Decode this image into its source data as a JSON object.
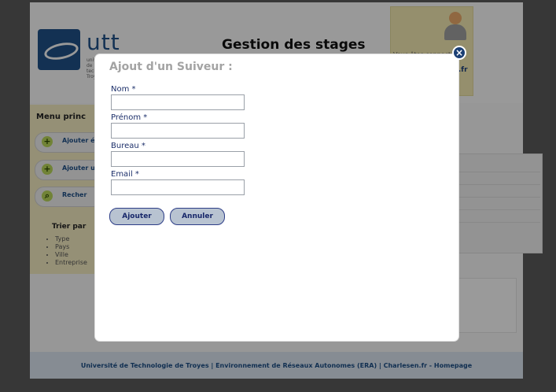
{
  "header": {
    "logo_text": "utt",
    "logo_subtext": "université de technologie Troyes",
    "app_title": "Gestion des stages",
    "user_text": "Vous êtes connecté",
    "user_link": "L.fr"
  },
  "sidebar": {
    "menu_title": "Menu princ",
    "buttons": [
      {
        "label": "Ajouter étudia"
      },
      {
        "label": "Ajouter un"
      },
      {
        "label": "Recher"
      }
    ],
    "sort_title": "Trier par",
    "sort_items": [
      "Type",
      "Pays",
      "Ville",
      "Entreprise"
    ]
  },
  "footer": {
    "text": "Université de Technologie de Troyes | Environnement de Réseaux Autonomes (ERA) | Charlesen.fr - Homepage"
  },
  "modal": {
    "title": "Ajout d'un Suiveur :",
    "fields": [
      {
        "label": "Nom *",
        "value": ""
      },
      {
        "label": "Prénom *",
        "value": ""
      },
      {
        "label": "Bureau *",
        "value": ""
      },
      {
        "label": "Email *",
        "value": ""
      }
    ],
    "buttons": {
      "add": "Ajouter",
      "cancel": "Annuler"
    },
    "close_icon": "×"
  }
}
